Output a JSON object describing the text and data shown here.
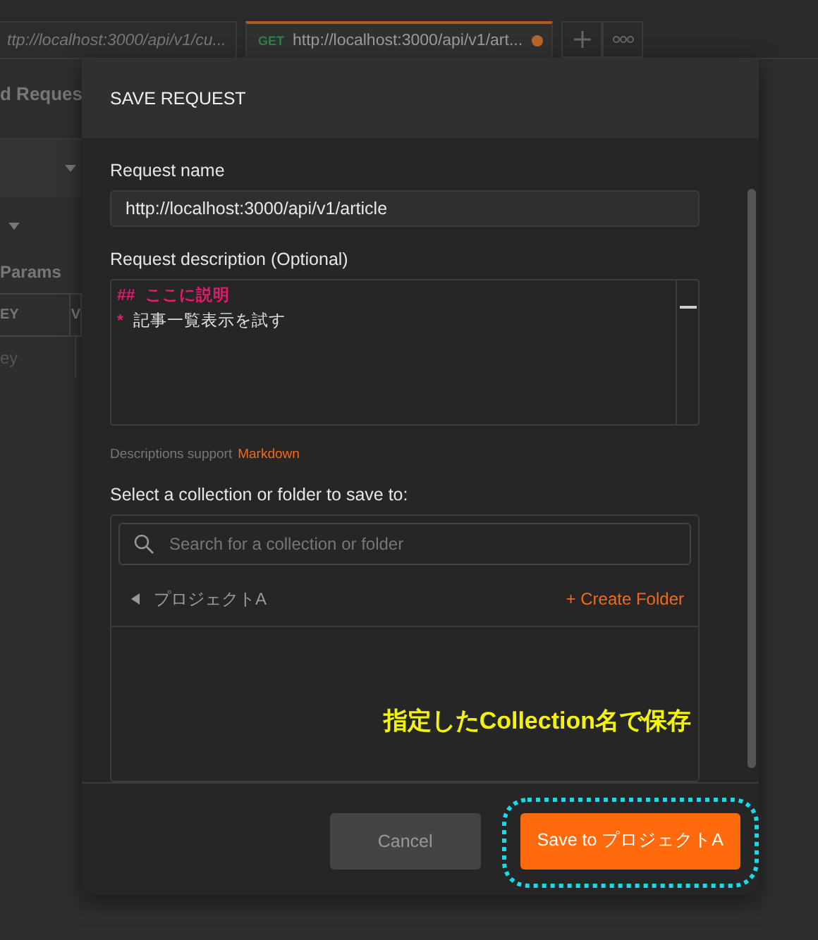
{
  "background": {
    "tabs": [
      {
        "label": "ttp://localhost:3000/api/v1/cu...",
        "selected": false,
        "unsaved": false
      },
      {
        "method": "GET",
        "label": "http://localhost:3000/api/v1/art...",
        "selected": true,
        "unsaved": true
      }
    ],
    "title": "d Reques",
    "section_tab": "Params",
    "table_columns": [
      "EY",
      "V"
    ],
    "key_placeholder": "ey"
  },
  "dialog": {
    "title": "SAVE REQUEST",
    "name_label": "Request name",
    "name_value": "http://localhost:3000/api/v1/article",
    "description_label": "Request description (Optional)",
    "description_lines": [
      {
        "kind": "heading",
        "marker": "##",
        "text": "ここに説明"
      },
      {
        "kind": "bullet",
        "marker": "*",
        "text": "記事一覧表示を試す"
      }
    ],
    "support_note": "Descriptions support",
    "support_link": "Markdown",
    "collection_label": "Select a collection or folder to save to:",
    "search_placeholder": "Search for a collection or folder",
    "collections": [
      {
        "name": "プロジェクトA",
        "expanded": false,
        "action": "+ Create Folder"
      }
    ],
    "annotation": "指定したCollection名で保存",
    "buttons": [
      {
        "kind": "secondary",
        "label": "Cancel",
        "highlighted": false
      },
      {
        "kind": "primary",
        "label": "Save to プロジェクトA",
        "highlighted": true
      }
    ]
  }
}
